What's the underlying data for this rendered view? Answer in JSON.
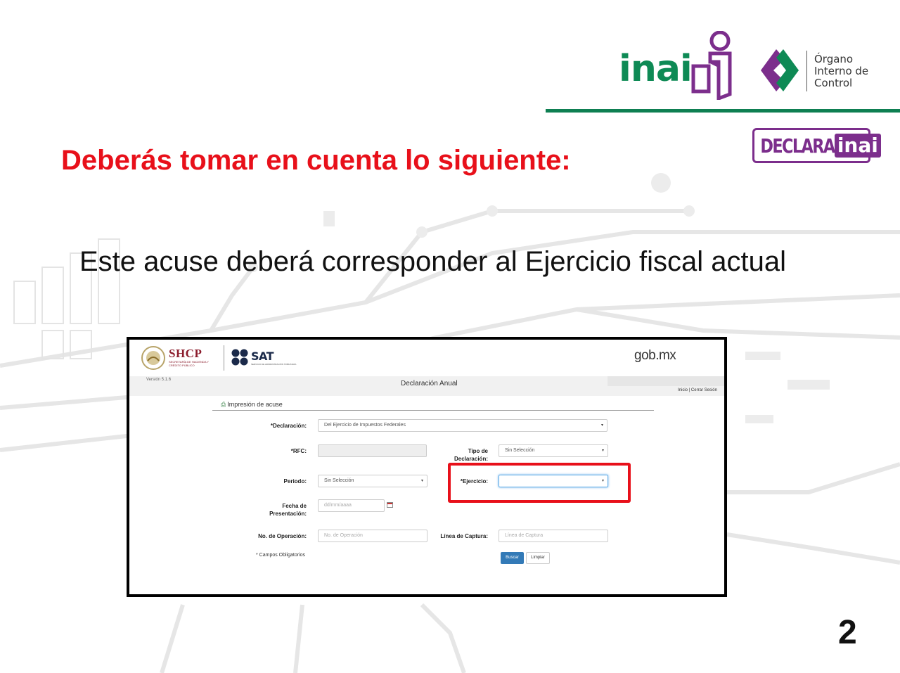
{
  "slide": {
    "heading": "Deberás tomar en cuenta lo siguiente:",
    "subtitle": "Este acuse deberá corresponder al Ejercicio fiscal actual",
    "page_number": "2"
  },
  "branding": {
    "inai_logo": "inai",
    "oic_line1": "Órgano",
    "oic_line2": "Interno de",
    "oic_line3": "Control",
    "declara_part": "DECLARA",
    "declara_inai_part": "inai"
  },
  "colors": {
    "heading_red": "#e8101a",
    "inai_green": "#0e8a55",
    "declara_purple": "#7c2e8c",
    "highlight_red": "#e8101a",
    "button_blue": "#337ab7"
  },
  "screenshot": {
    "header": {
      "shcp": "SHCP",
      "shcp_sub": "SECRETARÍA DE HACIENDA Y CRÉDITO PÚBLICO",
      "sat": "SAT",
      "sat_sub": "SERVICIO DE ADMINISTRACIÓN TRIBUTARIA",
      "gob": "gob.mx"
    },
    "version": "Versión 5.1.6",
    "page_title": "Declaración Anual",
    "top_links": "Inicio | Cerrar Sesión",
    "section_title": "Impresión de acuse",
    "form": {
      "declaracion_label": "*Declaración:",
      "declaracion_value": "Del Ejercicio de Impuestos Federales",
      "rfc_label": "*RFC:",
      "rfc_value": "",
      "tipo_label_1": "Tipo de",
      "tipo_label_2": "Declaración:",
      "tipo_value": "Sin Selección",
      "periodo_label": "Periodo:",
      "periodo_value": "Sin Selección",
      "ejercicio_label": "*Ejercicio:",
      "ejercicio_value": "",
      "fecha_label_1": "Fecha de",
      "fecha_label_2": "Presentación:",
      "fecha_placeholder": "dd/mm/aaaa",
      "operacion_label": "No. de Operación:",
      "operacion_placeholder": "No. de Operación",
      "linea_label": "Línea de Captura:",
      "linea_placeholder": "Línea de Captura",
      "required_note": "* Campos Obligatorios",
      "buscar": "Buscar",
      "limpiar": "Limpiar"
    }
  },
  "icons": {
    "printer": "printer-icon",
    "calendar": "calendar-icon",
    "select_caret": "chevron-down-icon"
  }
}
